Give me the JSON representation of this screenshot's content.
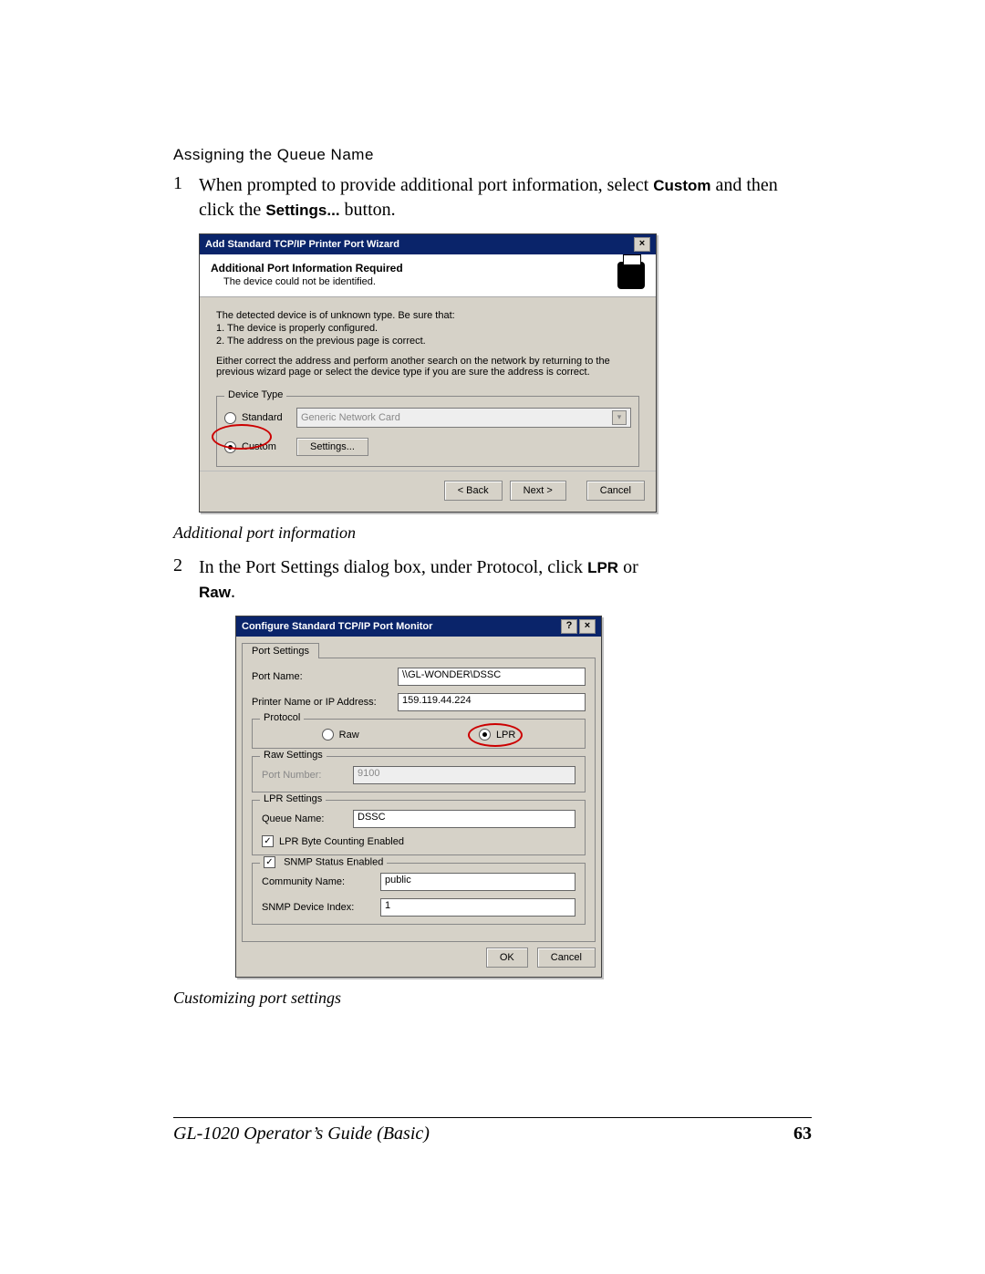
{
  "section": {
    "heading": "Assigning the Queue Name"
  },
  "step1": {
    "num": "1",
    "prefix": "When prompted to provide additional port information, select ",
    "bold1": "Custom",
    "mid": " and then click the ",
    "bold2": "Settings...",
    "suffix": " button."
  },
  "dlg1": {
    "title": "Add Standard TCP/IP Printer Port Wizard",
    "banner_h": "Additional Port Information Required",
    "banner_s": "The device could not be identified.",
    "body1": "The detected device is of unknown type. Be sure that:",
    "body2": "1. The device is properly configured.",
    "body3": "2. The address on the previous page is correct.",
    "body4": "Either correct the address and perform another search on the network by returning to the previous wizard page or select the device type if you are sure the address is correct.",
    "legend": "Device Type",
    "opt_std": "Standard",
    "opt_std_val": "Generic Network Card",
    "opt_custom": "Custom",
    "btn_settings": "Settings...",
    "btn_back": "< Back",
    "btn_next": "Next >",
    "btn_cancel": "Cancel"
  },
  "caption1": "Additional port information",
  "step2": {
    "num": "2",
    "prefix": "In the Port Settings dialog box, under Protocol, click ",
    "bold1": "LPR",
    "mid": " or ",
    "bold2": "Raw",
    "suffix": "."
  },
  "dlg2": {
    "title": "Configure Standard TCP/IP Port Monitor",
    "tab": "Port Settings",
    "lbl_portname": "Port Name:",
    "val_portname": "\\\\GL-WONDER\\DSSC",
    "lbl_ip": "Printer Name or IP Address:",
    "val_ip": "159.119.44.224",
    "leg_proto": "Protocol",
    "opt_raw": "Raw",
    "opt_lpr": "LPR",
    "leg_raw": "Raw Settings",
    "lbl_portnum": "Port Number:",
    "val_portnum": "9100",
    "leg_lpr": "LPR Settings",
    "lbl_queue": "Queue Name:",
    "val_queue": "DSSC",
    "chk_lprbc": "LPR Byte Counting Enabled",
    "chk_snmp": "SNMP Status Enabled",
    "lbl_comm": "Community Name:",
    "val_comm": "public",
    "lbl_devidx": "SNMP Device Index:",
    "val_devidx": "1",
    "btn_ok": "OK",
    "btn_cancel": "Cancel"
  },
  "caption2": "Customizing port settings",
  "footer": {
    "doc": "GL-1020 Operator’s Guide (Basic)",
    "page": "63"
  }
}
